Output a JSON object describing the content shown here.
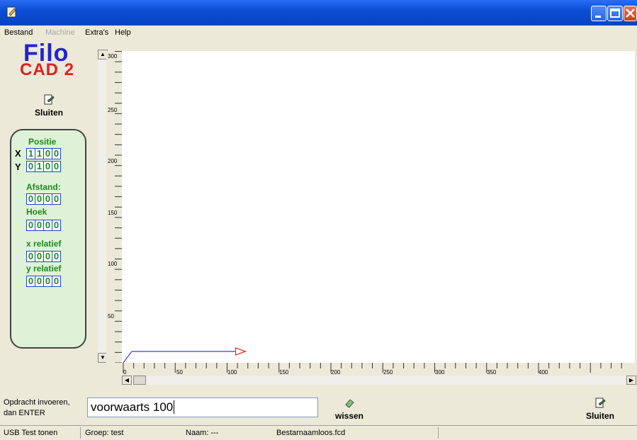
{
  "window": {
    "title": ""
  },
  "menu": {
    "items": [
      {
        "label": "Bestand",
        "disabled": false
      },
      {
        "label": "Machine",
        "disabled": true
      },
      {
        "label": "Extra's",
        "disabled": false
      },
      {
        "label": "Help",
        "disabled": false
      }
    ]
  },
  "logo": {
    "line1": "Filo",
    "line2": "CAD 2"
  },
  "left_toolbar": {
    "close_label": "Sluiten"
  },
  "info_panel": {
    "position_label": "Positie",
    "x_label": "X",
    "y_label": "Y",
    "x_digits": [
      "1",
      "1",
      "0",
      "0"
    ],
    "y_digits": [
      "0",
      "1",
      "0",
      "0"
    ],
    "distance_label": "Afstand:",
    "distance_digits": [
      "0",
      "0",
      "0",
      "0"
    ],
    "angle_label": "Hoek",
    "angle_digits": [
      "0",
      "0",
      "0",
      "0"
    ],
    "x_rel_label": "x relatief",
    "x_rel_digits": [
      "0",
      "0",
      "0",
      "0"
    ],
    "y_rel_label": "y relatief",
    "y_rel_digits": [
      "0",
      "0",
      "0",
      "0"
    ]
  },
  "ruler": {
    "vertical_labels": [
      "300",
      "250",
      "200",
      "150",
      "100",
      "50"
    ],
    "horizontal_labels": [
      "0",
      "50",
      "100",
      "150",
      "200",
      "250",
      "300",
      "350",
      "400"
    ]
  },
  "drawing": {
    "line_color": "#3344cc",
    "arrow_color": "#e03030",
    "command_distance": 100
  },
  "command": {
    "prompt_line1": "Opdracht invoeren,",
    "prompt_line2": "dan ENTER",
    "value": "voorwaarts 100",
    "clear_label": "wissen",
    "close_label": "Sluiten"
  },
  "status": {
    "usb": "USB Test tonen",
    "group": "Groep:  test",
    "name": "Naam: ---",
    "file": "Bestarnaamloos.fcd"
  },
  "icons": {
    "app": "app-icon",
    "close_tool": "close-doc-icon",
    "clear": "eraser-icon"
  }
}
